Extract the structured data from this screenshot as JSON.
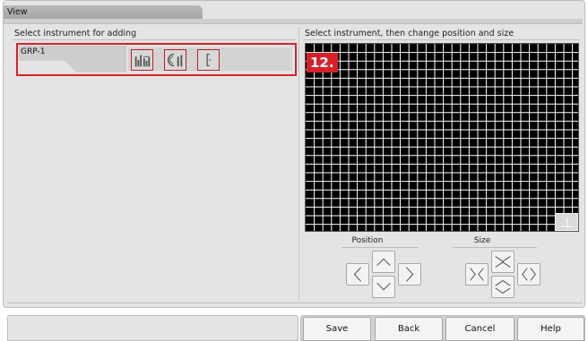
{
  "window": {
    "title": "View"
  },
  "left_panel": {
    "heading": "Select instrument for adding",
    "instrument_group": {
      "name": "GRP-1",
      "icons": [
        "bar-graph-icon",
        "dial-gauge-icon",
        "single-bar-icon"
      ]
    }
  },
  "right_panel": {
    "heading": "Select instrument, then change position and size",
    "step_badge": "12.",
    "position_label": "Position",
    "size_label": "Size"
  },
  "footer": {
    "buttons": {
      "save": "Save",
      "back": "Back",
      "cancel": "Cancel",
      "help": "Help"
    }
  },
  "colors": {
    "highlight": "#d7222b",
    "panel_background": "#e4e4e4",
    "grid_cells": "#000000",
    "grid_lines": "#ffffff"
  }
}
